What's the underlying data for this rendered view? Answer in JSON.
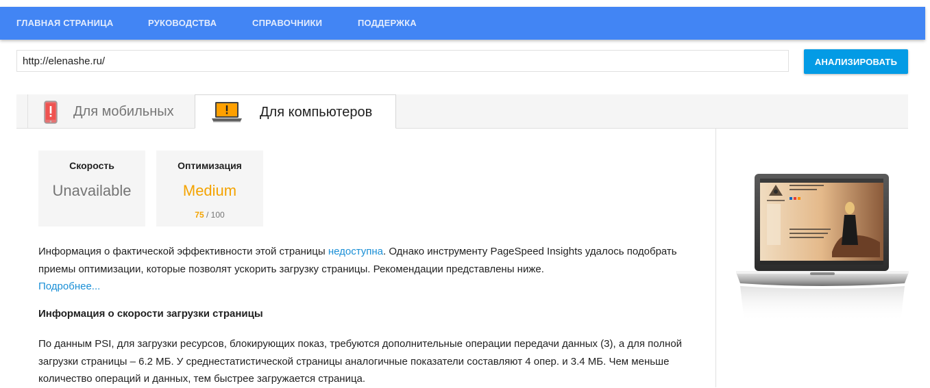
{
  "nav": {
    "items": [
      "ГЛАВНАЯ СТРАНИЦА",
      "РУКОВОДСТВА",
      "СПРАВОЧНИКИ",
      "ПОДДЕРЖКА"
    ]
  },
  "search": {
    "url_value": "http://elenashe.ru/",
    "analyze_label": "АНАЛИЗИРОВАТЬ"
  },
  "tabs": {
    "mobile": "Для мобильных",
    "desktop": "Для компьютеров"
  },
  "scores": {
    "speed": {
      "title": "Скорость",
      "value": "Unavailable"
    },
    "optimization": {
      "title": "Оптимизация",
      "value": "Medium",
      "score": "75",
      "max": "/ 100"
    }
  },
  "intro": {
    "before_link": "Информация о фактической эффективности этой страницы ",
    "link": "недоступна",
    "after_link": ". Однако инструменту PageSpeed Insights удалось подобрать приемы оптимизации, которые позволят ускорить загрузку страницы. Рекомендации представлены ниже.",
    "more": "Подробнее..."
  },
  "speed_info": {
    "title": "Информация о скорости загрузки страницы",
    "text": "По данным PSI, для загрузки ресурсов, блокирующих показ, требуются дополнительные операции передачи данных (3), а для полной загрузки страницы – 6.2 МБ. У среднестатистической страницы аналогичные показатели составляют 4 опер. и 3.4 МБ. Чем меньше количество операций и данных, тем быстрее загружается страница."
  },
  "colors": {
    "nav_bg": "#4285f4",
    "button_bg": "#039be5",
    "medium": "#f4a300",
    "link": "#1a8fd6"
  },
  "icons": {
    "mobile": "mobile-phone-alert-icon",
    "desktop": "laptop-alert-icon"
  }
}
